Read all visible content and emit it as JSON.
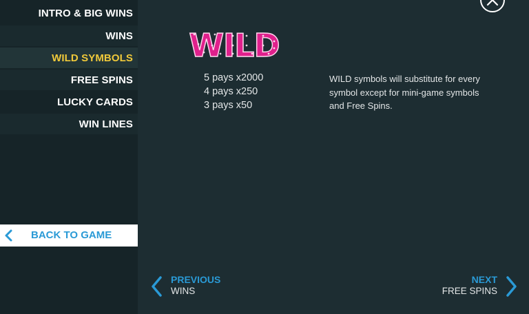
{
  "sidebar": {
    "items": [
      {
        "label": "INTRO & BIG WINS"
      },
      {
        "label": "WINS"
      },
      {
        "label": "WILD SYMBOLS"
      },
      {
        "label": "FREE SPINS"
      },
      {
        "label": "LUCKY CARDS"
      },
      {
        "label": "WIN LINES"
      }
    ],
    "active_item": "WILD SYMBOLS",
    "back_label": "BACK TO GAME"
  },
  "content": {
    "symbol_logo_text": "WILD",
    "pays": [
      "5 pays x2000",
      "4 pays x250",
      "3 pays x50"
    ],
    "description": "WILD symbols will substitute for every symbol except for mini-game symbols and Free Spins."
  },
  "footer_nav": {
    "previous": {
      "label": "PREVIOUS",
      "target": "WINS"
    },
    "next": {
      "label": "NEXT",
      "target": "FREE SPINS"
    }
  },
  "colors": {
    "accent_blue": "#2a9ad6",
    "active_yellow": "#f0c93a",
    "logo_pink": "#e0208c",
    "background": "#1d2d32",
    "sidebar": "#162428"
  },
  "icons": {
    "close": "close-icon",
    "back": "chevron-left-icon",
    "previous": "chevron-left-icon",
    "next": "chevron-right-icon"
  }
}
